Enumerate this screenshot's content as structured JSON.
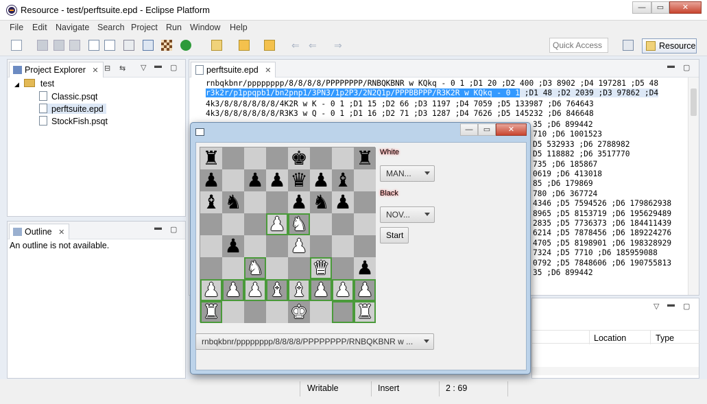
{
  "window": {
    "title": "Resource - test/perftsuite.epd - Eclipse Platform",
    "minimize": "—",
    "restore": "▭",
    "close": "✕"
  },
  "menu": [
    "File",
    "Edit",
    "Navigate",
    "Search",
    "Project",
    "Run",
    "Window",
    "Help"
  ],
  "toolbar": {
    "quick_access_placeholder": "Quick Access",
    "perspective": "Resource"
  },
  "project_explorer": {
    "tab": "Project Explorer",
    "project": "test",
    "files": [
      "Classic.psqt",
      "perftsuite.epd",
      "StockFish.psqt"
    ]
  },
  "outline": {
    "tab": "Outline",
    "message": "An outline is not available."
  },
  "editor": {
    "tab": "perftsuite.epd",
    "lines": [
      "rnbqkbnr/pppppppp/8/8/8/8/PPPPPPPP/RNBQKBNR w KQkq - 0 1 ;D1 20 ;D2 400 ;D3 8902 ;D4 197281 ;D5 48",
      "r3k2r/p1ppqpb1/bn2pnp1/3PN3/1p2P3/2N2Q1p/PPPBBPPP/R3K2R w KQkq - 0 1",
      " ;D1 48 ;D2 2039 ;D3 97862 ;D4",
      "4k3/8/8/8/8/8/8/4K2R w K - 0 1 ;D1 15 ;D2 66 ;D3 1197 ;D4 7059 ;D5 133987 ;D6 764643",
      "4k3/8/8/8/8/8/8/R3K3 w Q - 0 1 ;D1 16 ;D2 71 ;D3 1287 ;D4 7626 ;D5 145232 ;D6 846648"
    ],
    "right_lines": [
      "35 ;D6 899442",
      "710 ;D6 1001523",
      "D5 532933 ;D6 2788982",
      "D5 118882 ;D6 3517770",
      "735 ;D6 185867",
      "0619 ;D6 413018",
      "85 ;D6 179869",
      "780 ;D6 367724",
      "4346 ;D5 7594526 ;D6 179862938",
      "8965 ;D5 8153719 ;D6 195629489",
      "2835 ;D5 7736373 ;D6 184411439",
      "6214 ;D5 7878456 ;D6 189224276",
      "4705 ;D5 8198901 ;D6 198328929",
      "7324 ;D5 7710 ;D6 185959088",
      "0792 ;D5 7848606 ;D6 190755813",
      "35 ;D6 899442"
    ]
  },
  "problems": {
    "columns": [
      "Location",
      "Type"
    ]
  },
  "status": {
    "mode": "Writable",
    "insert": "Insert",
    "position": "2 : 69"
  },
  "dialog": {
    "white_label": "White",
    "white_value": "MAN...",
    "black_label": "Black",
    "black_value": "NOV...",
    "start": "Start",
    "fen_value": "rnbqkbnr/pppppppp/8/8/8/8/PPPPPPPP/RNBQKBNR w ...",
    "board": [
      [
        "bR",
        "",
        "",
        "",
        "bK",
        "",
        "",
        "bR"
      ],
      [
        "bP",
        "",
        "bP",
        "bP",
        "bQ",
        "bP",
        "bB",
        ""
      ],
      [
        "bB",
        "bN",
        "",
        "",
        "bP",
        "bN",
        "bP",
        ""
      ],
      [
        "",
        "",
        "",
        "wP",
        "wN",
        "",
        "",
        ""
      ],
      [
        "",
        "bP",
        "",
        "",
        "wP",
        "",
        "",
        ""
      ],
      [
        "",
        "",
        "wN",
        "",
        "",
        "wQ",
        "",
        "bP"
      ],
      [
        "wP",
        "wP",
        "wP",
        "wB",
        "wB",
        "wP",
        "wP",
        "wP"
      ],
      [
        "wR",
        "",
        "",
        "",
        "wK",
        "",
        "",
        "wR"
      ]
    ],
    "highlights": [
      [
        3,
        3
      ],
      [
        3,
        4
      ],
      [
        5,
        5
      ],
      [
        6,
        0
      ],
      [
        6,
        1
      ],
      [
        6,
        2
      ],
      [
        6,
        3
      ],
      [
        6,
        4
      ],
      [
        6,
        5
      ],
      [
        6,
        6
      ],
      [
        6,
        7
      ],
      [
        7,
        0
      ],
      [
        7,
        7
      ],
      [
        7,
        6
      ],
      [
        5,
        2
      ]
    ]
  }
}
